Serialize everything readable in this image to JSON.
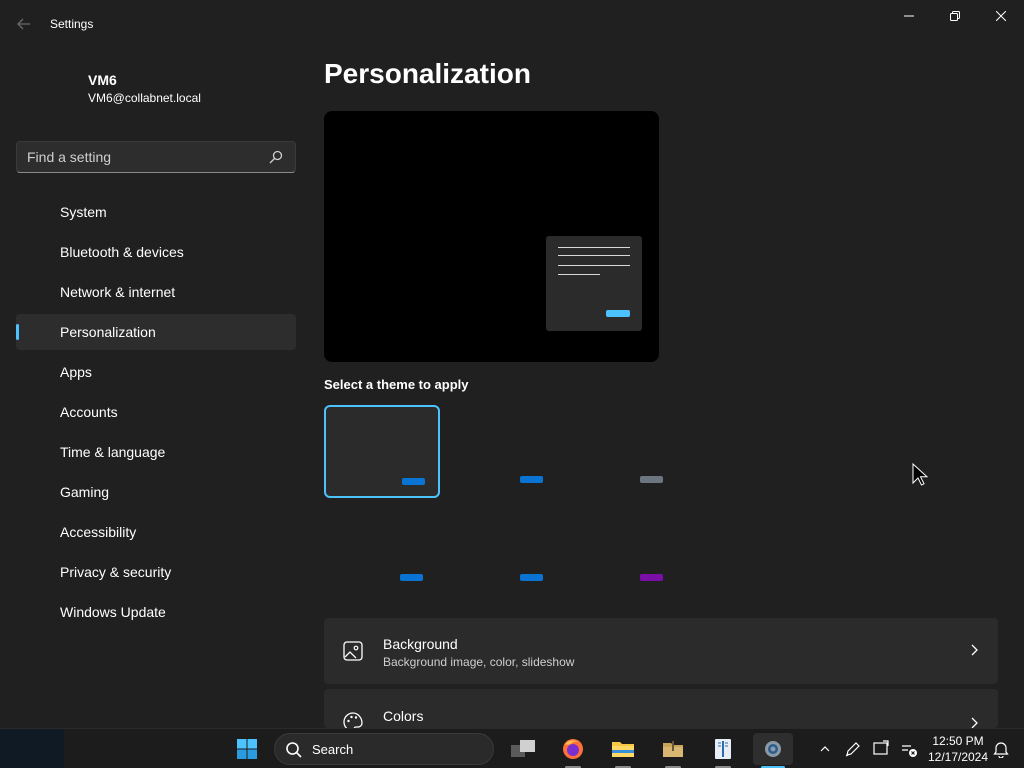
{
  "window": {
    "title": "Settings"
  },
  "profile": {
    "name": "VM6",
    "email": "VM6@collabnet.local"
  },
  "search": {
    "placeholder": "Find a setting"
  },
  "sidebar": {
    "items": [
      {
        "label": "System"
      },
      {
        "label": "Bluetooth & devices"
      },
      {
        "label": "Network & internet"
      },
      {
        "label": "Personalization",
        "active": true
      },
      {
        "label": "Apps"
      },
      {
        "label": "Accounts"
      },
      {
        "label": "Time & language"
      },
      {
        "label": "Gaming"
      },
      {
        "label": "Accessibility"
      },
      {
        "label": "Privacy & security"
      },
      {
        "label": "Windows Update"
      }
    ]
  },
  "main": {
    "title": "Personalization",
    "theme_section_label": "Select a theme to apply",
    "themes": [
      {
        "swatch": "#0a74d4",
        "selected": true
      },
      {
        "swatch": "#0a74d4"
      },
      {
        "swatch": "#6b7680"
      },
      {
        "swatch": "#0a74d4"
      },
      {
        "swatch": "#0a74d4"
      },
      {
        "swatch": "#7a0fa8"
      }
    ],
    "cards": [
      {
        "title": "Background",
        "subtitle": "Background image, color, slideshow",
        "icon": "image-icon"
      },
      {
        "title": "Colors",
        "subtitle": "",
        "icon": "palette-icon"
      }
    ]
  },
  "taskbar": {
    "search_label": "Search",
    "time": "12:50 PM",
    "date": "12/17/2024"
  },
  "colors": {
    "accent": "#4cc2ff",
    "background": "#202020",
    "card": "#2b2b2b"
  }
}
